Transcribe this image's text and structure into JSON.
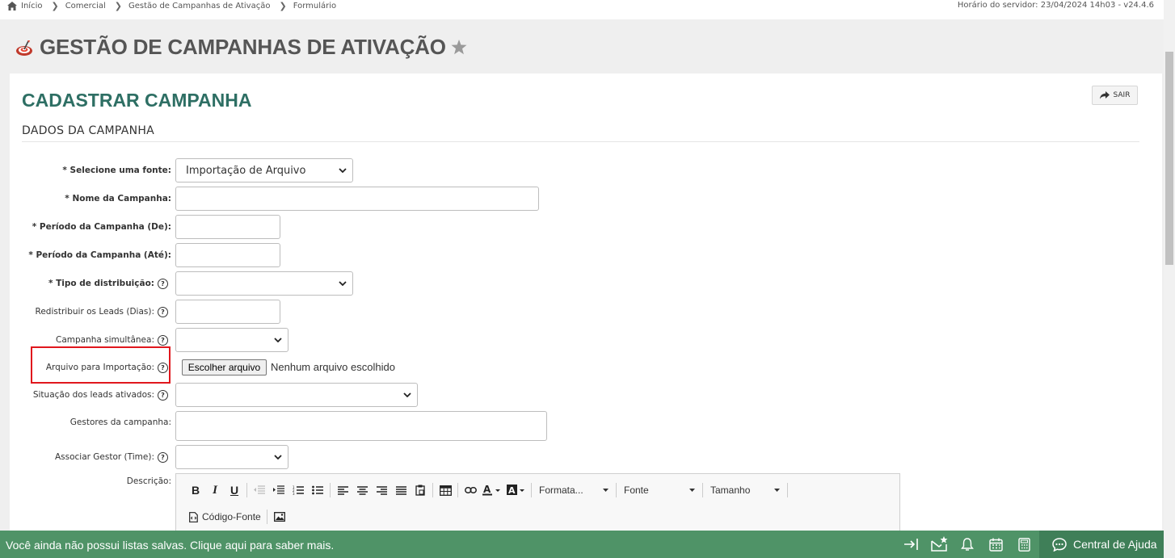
{
  "breadcrumb": {
    "items": [
      "Início",
      "Comercial",
      "Gestão de Campanhas de Ativação",
      "Formulário"
    ]
  },
  "server_time": "Horário do servidor: 23/04/2024 14h03 - v24.4.6",
  "page_title": "GESTÃO DE CAMPANHAS DE ATIVAÇÃO",
  "panel": {
    "title": "CADASTRAR CAMPANHA",
    "exit_label": "SAIR",
    "section": "DADOS DA CAMPANHA"
  },
  "form": {
    "fonte_label": "* Selecione uma fonte:",
    "fonte_value": "Importação de Arquivo",
    "nome_label": "* Nome da Campanha:",
    "nome_value": "",
    "periodo_de_label": "* Período da Campanha (De):",
    "periodo_ate_label": "* Período da Campanha (Até):",
    "tipo_label": "* Tipo de distribuição:",
    "tipo_value": "",
    "redistribuir_label": "Redistribuir os Leads (Dias):",
    "simultanea_label": "Campanha simultânea:",
    "arquivo_label": "Arquivo para Importação:",
    "arquivo_button": "Escolher arquivo",
    "arquivo_status": "Nenhum arquivo escolhido",
    "situacao_label": "Situação dos leads ativados:",
    "gestores_label": "Gestores da campanha:",
    "associar_label": "Associar Gestor (Time):",
    "descricao_label": "Descrição:"
  },
  "editor": {
    "bold": "B",
    "italic": "I",
    "underline": "U",
    "format_combo": "Formata...",
    "font_combo": "Fonte",
    "size_combo": "Tamanho",
    "source_button": "Código-Fonte"
  },
  "bottom_bar": {
    "message": "Você ainda não possui listas salvas. Clique aqui para saber mais.",
    "help_center": "Central de Ajuda"
  },
  "colors": {
    "accent_teal": "#2e6f64",
    "bottom_bar_green": "#4f9367",
    "highlight_red": "#e0171d"
  }
}
